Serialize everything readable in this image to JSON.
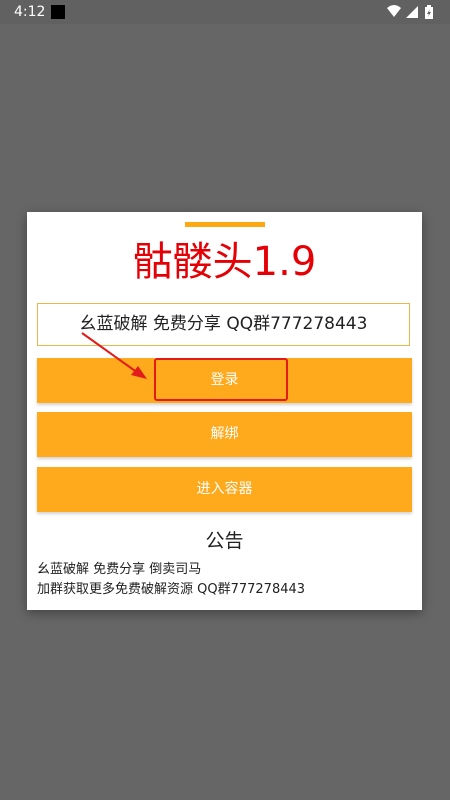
{
  "status_bar": {
    "time": "4:12",
    "icons": [
      "notification-square-icon",
      "wifi-icon",
      "cellular-signal-icon",
      "battery-charging-icon"
    ]
  },
  "dialog": {
    "title": "骷髅头1.9",
    "info_text": "幺蓝破解 免费分享 QQ群777278443",
    "buttons": {
      "login": "登录",
      "unbind": "解绑",
      "enter_container": "进入容器"
    },
    "announcement": {
      "title": "公告",
      "lines": [
        "幺蓝破解 免费分享 倒卖司马",
        "加群获取更多免费破解资源 QQ群777278443"
      ]
    }
  },
  "colors": {
    "accent": "#ffa91c",
    "title_red": "#e50006",
    "backdrop": "#666666",
    "annotation_red": "#e21b1b"
  }
}
